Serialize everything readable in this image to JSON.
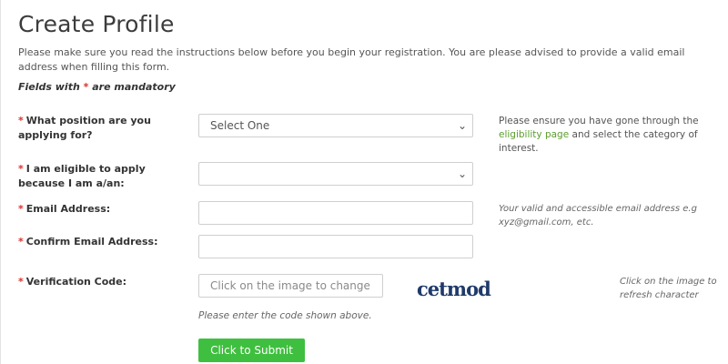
{
  "page": {
    "title": "Create Profile",
    "intro": "Please make sure you read the instructions below before you begin your registration. You are please advised to provide a valid email address when filling this form.",
    "mandatory_prefix": "Fields with",
    "mandatory_star": "*",
    "mandatory_suffix": "are mandatory"
  },
  "form": {
    "position": {
      "star": "*",
      "label": "What position are you applying for?",
      "selected": "Select One",
      "hint_before": "Please ensure you have gone through the",
      "hint_link": "eligibility page",
      "hint_after": "and select the category of interest."
    },
    "eligibility": {
      "star": "*",
      "label": "I am eligible to apply because I am a/an:",
      "selected": ""
    },
    "email": {
      "star": "*",
      "label": "Email Address:",
      "value": "",
      "hint": "Your valid and accessible email address e.g xyz@gmail.com, etc."
    },
    "confirm_email": {
      "star": "*",
      "label": "Confirm Email Address:",
      "value": ""
    },
    "verification": {
      "star": "*",
      "label": "Verification Code:",
      "placeholder": "Click on the image to change characters",
      "captcha_text": "cetmod",
      "hint": "Click on the image to refresh character",
      "below": "Please enter the code shown above."
    },
    "submit_label": "Click to Submit"
  },
  "icons": {
    "chevron": "chevron-down-icon"
  },
  "colors": {
    "accent_green": "#3fbf3f",
    "link_green": "#5a9c2e",
    "required_red": "#d9312d",
    "captcha_blue": "#1f3a6b"
  }
}
